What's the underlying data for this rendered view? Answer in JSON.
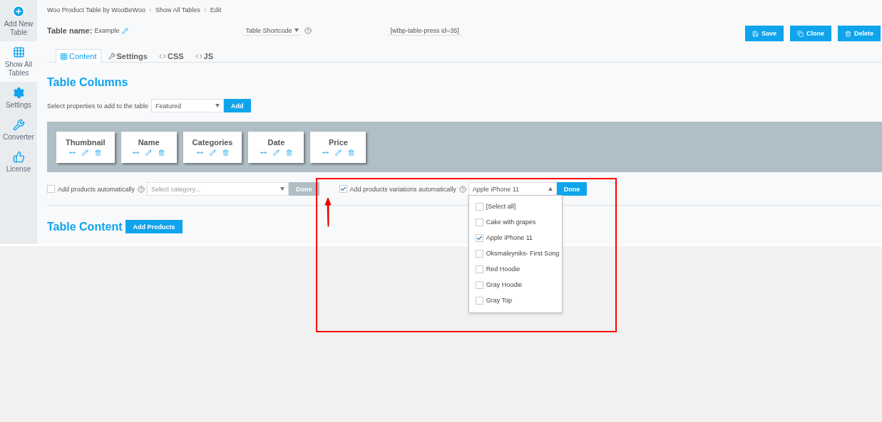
{
  "sidebar": {
    "items": [
      {
        "kind": "add",
        "label": "Add New Table",
        "selected": false
      },
      {
        "kind": "grid",
        "label": "Show All Tables",
        "selected": true
      },
      {
        "kind": "gear",
        "label": "Settings",
        "selected": false
      },
      {
        "kind": "wrench",
        "label": "Converter",
        "selected": false
      },
      {
        "kind": "hand",
        "label": "License",
        "selected": false
      }
    ]
  },
  "breadcrumb": [
    "Woo Product Table by WooBeWoo",
    "Show All Tables",
    "Edit"
  ],
  "table_name": {
    "label": "Table name:",
    "value": "Example"
  },
  "shortcode": {
    "label": "Table Shortcode",
    "value": "[wtbp-table-press id=35]"
  },
  "actions": [
    {
      "kind": "save",
      "label": "Save"
    },
    {
      "kind": "clone",
      "label": "Clone"
    },
    {
      "kind": "delete",
      "label": "Delete"
    }
  ],
  "tabs": [
    {
      "kind": "grid",
      "label": "Content",
      "selected": true
    },
    {
      "kind": "wrench",
      "label": "Settings",
      "selected": false
    },
    {
      "kind": "code",
      "label": "CSS",
      "selected": false
    },
    {
      "kind": "code",
      "label": "JS",
      "selected": false
    }
  ],
  "columns_title": "Table Columns",
  "properties": {
    "label": "Select properties to add to the table",
    "value": "Featured",
    "button": "Add"
  },
  "columns": [
    {
      "label": "Thumbnail"
    },
    {
      "label": "Name"
    },
    {
      "label": "Categories"
    },
    {
      "label": "Date"
    },
    {
      "label": "Price"
    }
  ],
  "auto_products": {
    "checked": false,
    "label": "Add products automatically",
    "placeholder": "Select category...",
    "button": "Done",
    "disabled": true
  },
  "variations": {
    "checked": true,
    "label": "Add products variations automatically",
    "value": "Apple iPhone 11",
    "button": "Done",
    "disabled": false,
    "expanded": true,
    "options": [
      {
        "label": "[Select all]",
        "checked": false
      },
      {
        "label": "Cake with grapes",
        "checked": false
      },
      {
        "label": "Apple iPhone 11",
        "checked": true
      },
      {
        "label": "Oksmaleyniks- First Song",
        "checked": false
      },
      {
        "label": "Red Hoodie",
        "checked": false
      },
      {
        "label": "Gray Hoodie",
        "checked": false
      },
      {
        "label": "Gray Top",
        "checked": false
      }
    ]
  },
  "table_content": {
    "title": "Table Content",
    "button": "Add Products"
  }
}
